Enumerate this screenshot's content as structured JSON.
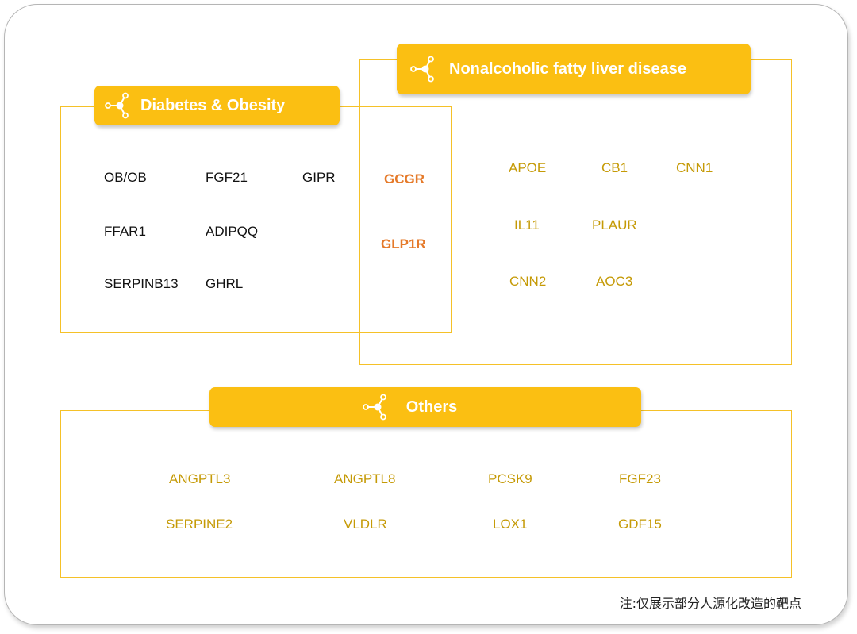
{
  "groups": {
    "diabetes": {
      "title": "Diabetes & Obesity",
      "icon": "network-node-icon",
      "items": [
        "OB/OB",
        "FGF21",
        "GIPR",
        "FFAR1",
        "ADIPQQ",
        "SERPINB13",
        "GHRL"
      ]
    },
    "nafld": {
      "title": "Nonalcoholic fatty liver disease",
      "icon": "network-node-icon",
      "items": [
        "APOE",
        "CB1",
        "CNN1",
        "IL11",
        "PLAUR",
        "CNN2",
        "AOC3"
      ]
    },
    "overlap": {
      "items": [
        "GCGR",
        "GLP1R"
      ]
    },
    "others": {
      "title": "Others",
      "icon": "network-node-icon",
      "items": [
        "ANGPTL3",
        "ANGPTL8",
        "PCSK9",
        "FGF23",
        "SERPINE2",
        "VLDLR",
        "LOX1",
        "GDF15"
      ]
    }
  },
  "note": "注:仅展示部分人源化改造的靶点",
  "colors": {
    "accent": "#fbbf12",
    "border": "#f5c128",
    "gold_text": "#c59a06",
    "overlap_text": "#e57a2a",
    "dark_text": "#111111"
  }
}
